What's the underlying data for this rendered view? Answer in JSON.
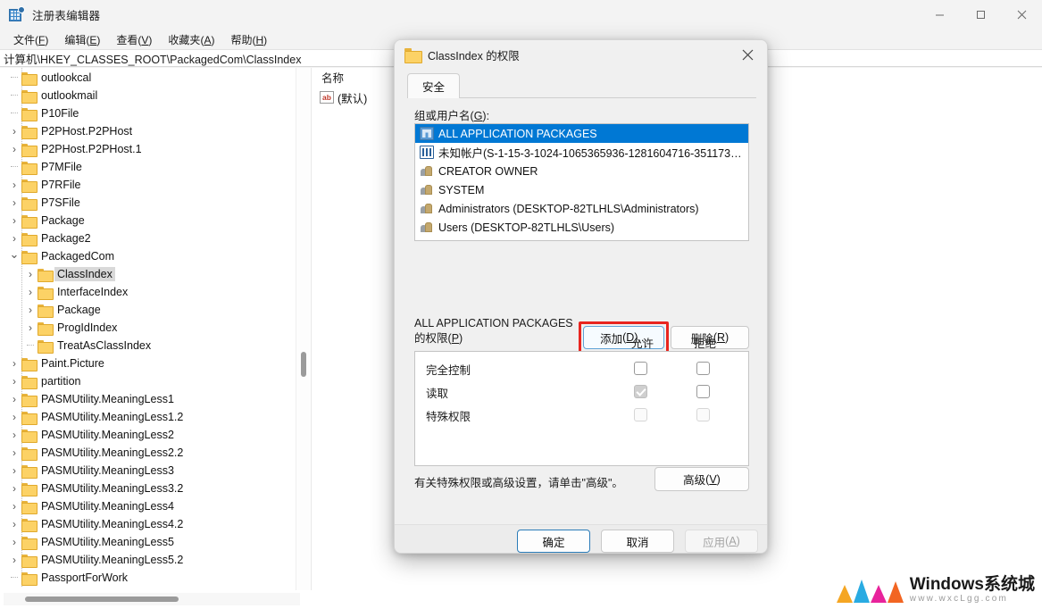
{
  "window": {
    "title": "注册表编辑器",
    "icon": "registry-icon",
    "controls": {
      "minimize": "minimize-icon",
      "maximize": "maximize-icon",
      "close": "close-icon"
    }
  },
  "menu": {
    "items": [
      {
        "text": "文件",
        "accel": "F"
      },
      {
        "text": "编辑",
        "accel": "E"
      },
      {
        "text": "查看",
        "accel": "V"
      },
      {
        "text": "收藏夹",
        "accel": "A"
      },
      {
        "text": "帮助",
        "accel": "H"
      }
    ]
  },
  "address": {
    "path": "计算机\\HKEY_CLASSES_ROOT\\PackagedCom\\ClassIndex"
  },
  "tree": {
    "nodes": [
      {
        "label": "outlookcal",
        "indent": 1,
        "arrow": "none",
        "selected": false
      },
      {
        "label": "outlookmail",
        "indent": 1,
        "arrow": "none",
        "selected": false
      },
      {
        "label": "P10File",
        "indent": 1,
        "arrow": "none",
        "selected": false
      },
      {
        "label": "P2PHost.P2PHost",
        "indent": 1,
        "arrow": "collapsed",
        "selected": false
      },
      {
        "label": "P2PHost.P2PHost.1",
        "indent": 1,
        "arrow": "collapsed",
        "selected": false
      },
      {
        "label": "P7MFile",
        "indent": 1,
        "arrow": "none",
        "selected": false
      },
      {
        "label": "P7RFile",
        "indent": 1,
        "arrow": "collapsed",
        "selected": false
      },
      {
        "label": "P7SFile",
        "indent": 1,
        "arrow": "collapsed",
        "selected": false
      },
      {
        "label": "Package",
        "indent": 1,
        "arrow": "collapsed",
        "selected": false
      },
      {
        "label": "Package2",
        "indent": 1,
        "arrow": "collapsed",
        "selected": false
      },
      {
        "label": "PackagedCom",
        "indent": 1,
        "arrow": "expanded",
        "selected": false
      },
      {
        "label": "ClassIndex",
        "indent": 2,
        "arrow": "collapsed",
        "selected": true
      },
      {
        "label": "InterfaceIndex",
        "indent": 2,
        "arrow": "collapsed",
        "selected": false
      },
      {
        "label": "Package",
        "indent": 2,
        "arrow": "collapsed",
        "selected": false
      },
      {
        "label": "ProgIdIndex",
        "indent": 2,
        "arrow": "collapsed",
        "selected": false
      },
      {
        "label": "TreatAsClassIndex",
        "indent": 2,
        "arrow": "none",
        "selected": false
      },
      {
        "label": "Paint.Picture",
        "indent": 1,
        "arrow": "collapsed",
        "selected": false
      },
      {
        "label": "partition",
        "indent": 1,
        "arrow": "collapsed",
        "selected": false
      },
      {
        "label": "PASMUtility.MeaningLess1",
        "indent": 1,
        "arrow": "collapsed",
        "selected": false
      },
      {
        "label": "PASMUtility.MeaningLess1.2",
        "indent": 1,
        "arrow": "collapsed",
        "selected": false
      },
      {
        "label": "PASMUtility.MeaningLess2",
        "indent": 1,
        "arrow": "collapsed",
        "selected": false
      },
      {
        "label": "PASMUtility.MeaningLess2.2",
        "indent": 1,
        "arrow": "collapsed",
        "selected": false
      },
      {
        "label": "PASMUtility.MeaningLess3",
        "indent": 1,
        "arrow": "collapsed",
        "selected": false
      },
      {
        "label": "PASMUtility.MeaningLess3.2",
        "indent": 1,
        "arrow": "collapsed",
        "selected": false
      },
      {
        "label": "PASMUtility.MeaningLess4",
        "indent": 1,
        "arrow": "collapsed",
        "selected": false
      },
      {
        "label": "PASMUtility.MeaningLess4.2",
        "indent": 1,
        "arrow": "collapsed",
        "selected": false
      },
      {
        "label": "PASMUtility.MeaningLess5",
        "indent": 1,
        "arrow": "collapsed",
        "selected": false
      },
      {
        "label": "PASMUtility.MeaningLess5.2",
        "indent": 1,
        "arrow": "collapsed",
        "selected": false
      },
      {
        "label": "PassportForWork",
        "indent": 1,
        "arrow": "none",
        "selected": false
      }
    ]
  },
  "list": {
    "header": "名称",
    "rows": [
      {
        "icon": "ab-string-icon",
        "name": "(默认)"
      }
    ]
  },
  "dialog": {
    "title": "ClassIndex 的权限",
    "close_icon": "close-icon",
    "tab": "安全",
    "group_label": "组或用户名",
    "group_accel": "G",
    "users": [
      {
        "name": "ALL APPLICATION PACKAGES",
        "icon": "package-icon",
        "selected": true
      },
      {
        "name": "未知帐户(S-1-15-3-1024-1065365936-1281604716-351173…",
        "icon": "unknown-account-icon",
        "selected": false
      },
      {
        "name": "CREATOR OWNER",
        "icon": "user-group-icon",
        "selected": false
      },
      {
        "name": "SYSTEM",
        "icon": "user-group-icon",
        "selected": false
      },
      {
        "name": "Administrators (DESKTOP-82TLHLS\\Administrators)",
        "icon": "user-group-icon",
        "selected": false
      },
      {
        "name": "Users (DESKTOP-82TLHLS\\Users)",
        "icon": "user-group-icon",
        "selected": false
      }
    ],
    "add_button": {
      "text": "添加",
      "accel": "D",
      "suffix": "..."
    },
    "remove_button": {
      "text": "删除",
      "accel": "R"
    },
    "perm_label_line1": "ALL APPLICATION PACKAGES",
    "perm_label_line2": "的权限",
    "perm_label_accel": "P",
    "col_allow": "允许",
    "col_deny": "拒绝",
    "permissions": [
      {
        "name": "完全控制",
        "allow": "unchecked",
        "deny": "unchecked"
      },
      {
        "name": "读取",
        "allow": "checked-disabled",
        "deny": "unchecked"
      },
      {
        "name": "特殊权限",
        "allow": "disabled",
        "deny": "disabled"
      }
    ],
    "advanced_hint": "有关特殊权限或高级设置，请单击\"高级\"。",
    "advanced_button": {
      "text": "高级",
      "accel": "V"
    },
    "ok_button": "确定",
    "cancel_button": "取消",
    "apply_button": {
      "text": "应用",
      "accel": "A"
    },
    "highlight_color": "#e8251f",
    "selection_color": "#0078d4"
  },
  "watermark": {
    "main": "Windows系统城",
    "sub": "www.wxcLgg.com",
    "colors": [
      "#f5a623",
      "#29abe2",
      "#e8239b",
      "#f26522"
    ]
  }
}
